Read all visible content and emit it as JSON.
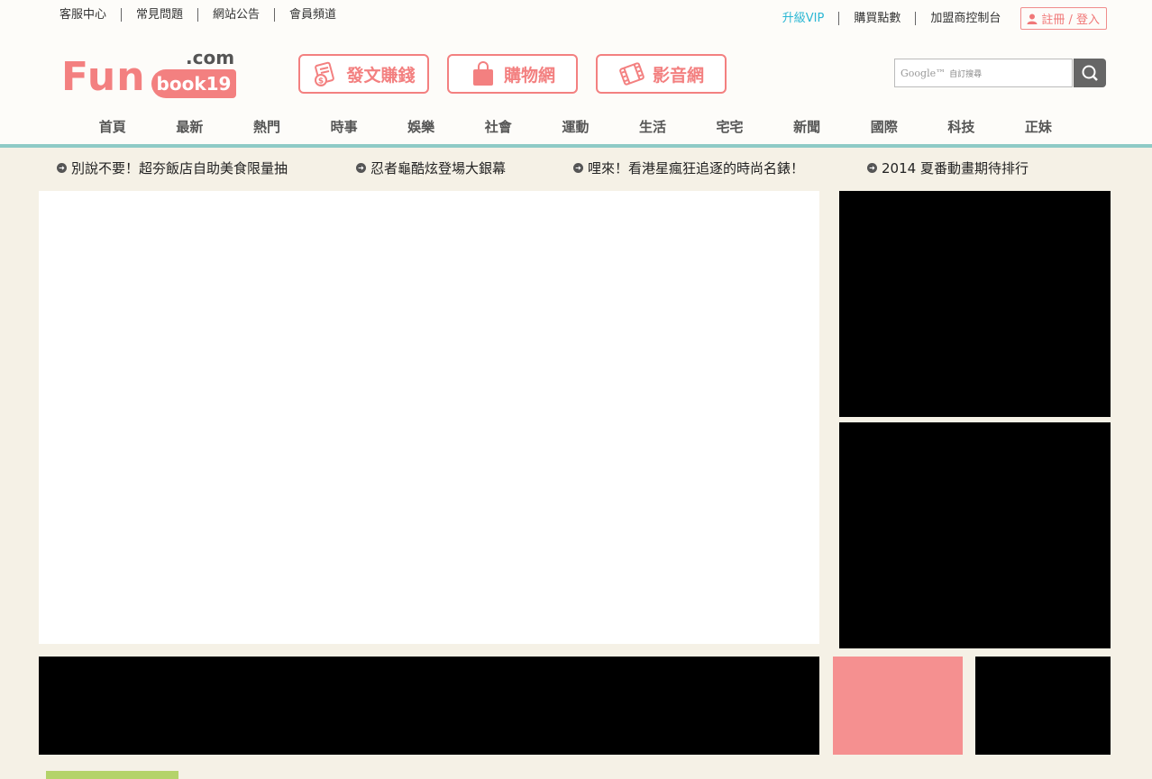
{
  "topbar": {
    "left_links": [
      "客服中心",
      "常見問題",
      "網站公告",
      "會員頻道"
    ],
    "vip": "升級VIP",
    "buy_points": "購買點數",
    "partner_console": "加盟商控制台",
    "login": "註冊 / 登入"
  },
  "logo": {
    "fun": "Fun",
    "book": "book19",
    "dotcom": ".com"
  },
  "feature_buttons": [
    {
      "label": "發文賺錢",
      "icon": "money-document-icon"
    },
    {
      "label": "購物網",
      "icon": "shopping-bag-icon"
    },
    {
      "label": "影音網",
      "icon": "film-icon"
    }
  ],
  "search": {
    "google_label": "Google™",
    "placeholder": "自訂搜尋"
  },
  "nav": [
    "首頁",
    "最新",
    "熱門",
    "時事",
    "娛樂",
    "社會",
    "運動",
    "生活",
    "宅宅",
    "新聞",
    "國際",
    "科技",
    "正妹"
  ],
  "headlines": [
    "別說不要！超夯飯店自助美食限量抽",
    "忍者龜酷炫登場大銀幕",
    "哩來！看港星瘋狂追逐的時尚名錶！",
    "2014 夏番動畫期待排行"
  ],
  "colors": {
    "brand_pink": "#f38080",
    "vip_cyan": "#2bb7d4",
    "teal_line": "#8ecac6",
    "ad_pink": "#f59090",
    "green_tab": "#b4d36a",
    "page_bg": "#f5f1e6"
  }
}
